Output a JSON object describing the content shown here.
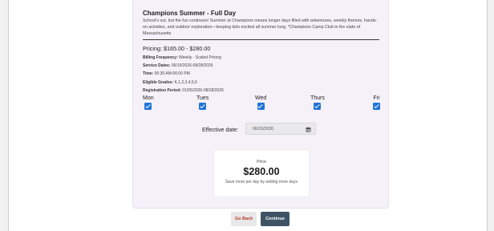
{
  "program": {
    "title": "Champions Summer - Full Day",
    "description": "School's out, but the fun continues! Summer at Champions means longer days filled with adventures, weekly themes, hands-on activities, and outdoor exploration—keeping kids excited all summer long. *Champions Camp Club in the state of Massachusetts",
    "pricing": "Pricing: $165.00 - $280.00",
    "details": [
      {
        "label": "Billing Frequency:",
        "value": "Weekly - Scaled Pricing"
      },
      {
        "label": "Service Dates:",
        "value": "06/15/2026-08/28/2026"
      },
      {
        "label": "Time:",
        "value": "06:30 AM-06:00 PM"
      },
      {
        "label": "Eligible Grades:",
        "value": "K,1,2,3,4,5,6"
      },
      {
        "label": "Registration Period:",
        "value": "01/05/2026-08/28/2026"
      }
    ]
  },
  "days": [
    {
      "label": "Mon",
      "checked": true
    },
    {
      "label": "Tues",
      "checked": true
    },
    {
      "label": "Wed",
      "checked": true
    },
    {
      "label": "Thurs",
      "checked": true
    },
    {
      "label": "Fri",
      "checked": true
    }
  ],
  "effective_date": {
    "label": "Effective date:",
    "value": "06/15/2026"
  },
  "price_box": {
    "label": "Price",
    "value": "$280.00",
    "note": "Save more per day by adding more days"
  },
  "actions": {
    "back_label": "Go Back",
    "continue_label": "Continue"
  },
  "colors": {
    "checkbox": "#1f74d8",
    "continue_button": "#3f5366",
    "back_text": "#c0392b",
    "card_bg": "#f6f1f9"
  },
  "icons": {
    "date_picker": "calendar-icon",
    "day_check": "checkbox-checked-icon"
  }
}
